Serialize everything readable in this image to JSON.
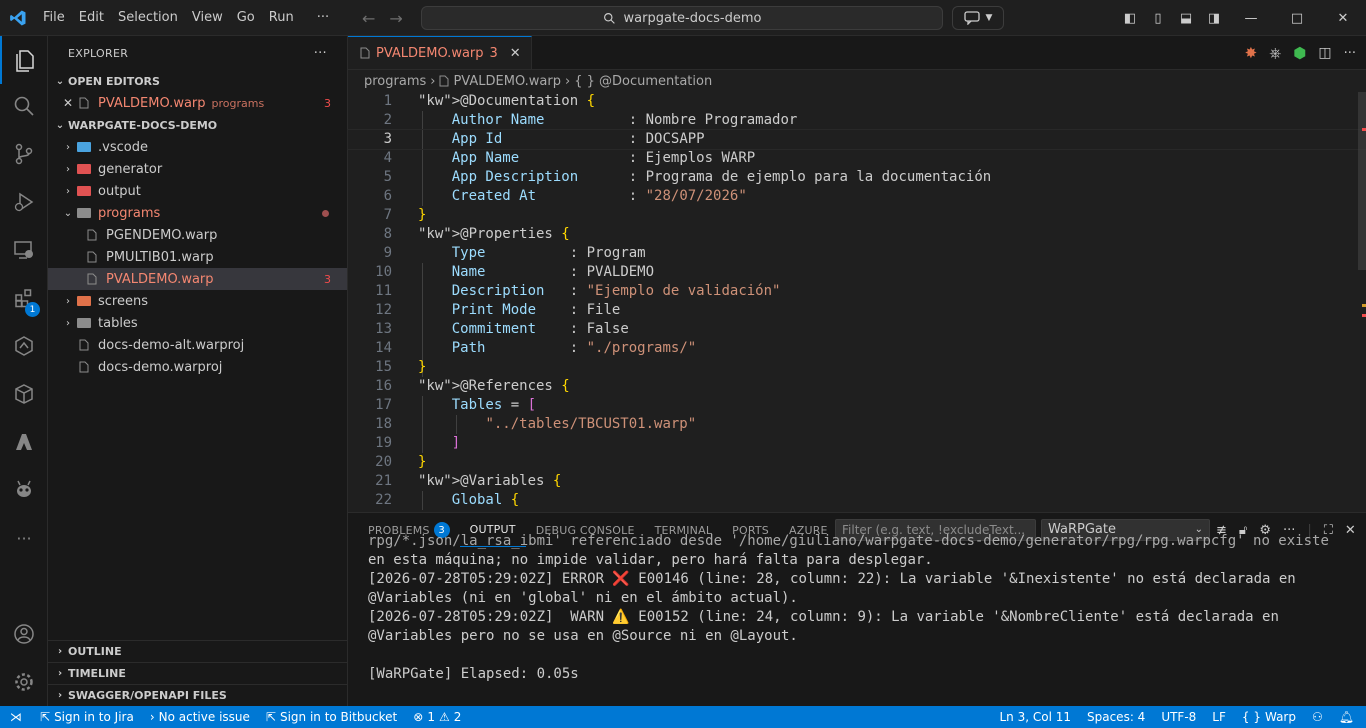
{
  "titlebar": {
    "menu": [
      "File",
      "Edit",
      "Selection",
      "View",
      "Go",
      "Run",
      "···"
    ],
    "search": "warpgate-docs-demo"
  },
  "activity": {
    "items": [
      "files-icon",
      "search-icon",
      "source-control-icon",
      "run-debug-icon",
      "remote-explorer-icon",
      "extensions-icon",
      "warp-icon",
      "cube-icon",
      "azure-icon",
      "alien-icon",
      "more-icon",
      "account-icon",
      "settings-icon"
    ],
    "extensions_badge": "1"
  },
  "sidebar": {
    "title": "EXPLORER",
    "more": "···",
    "open_editors": {
      "title": "OPEN EDITORS",
      "items": [
        {
          "name": "PVALDEMO.warp",
          "desc": "programs",
          "count": "3"
        }
      ]
    },
    "workspace": {
      "title": "WARPGATE-DOCS-DEMO",
      "items": [
        {
          "name": ".vscode",
          "type": "folder",
          "color": "#4aa3df"
        },
        {
          "name": "generator",
          "type": "folder",
          "color": "#e05252"
        },
        {
          "name": "output",
          "type": "folder",
          "color": "#e05252"
        },
        {
          "name": "programs",
          "type": "folder-open",
          "color": "#8c8c8c"
        },
        {
          "name": "PGENDEMO.warp",
          "type": "file"
        },
        {
          "name": "PMULTIB01.warp",
          "type": "file"
        },
        {
          "name": "PVALDEMO.warp",
          "type": "file",
          "count": "3"
        },
        {
          "name": "screens",
          "type": "folder",
          "color": "#e0724a"
        },
        {
          "name": "tables",
          "type": "folder",
          "color": "#8c8c8c"
        },
        {
          "name": "docs-demo-alt.warproj",
          "type": "file"
        },
        {
          "name": "docs-demo.warproj",
          "type": "file"
        }
      ]
    },
    "bottom_sections": [
      "OUTLINE",
      "TIMELINE",
      "SWAGGER/OPENAPI FILES"
    ]
  },
  "editor": {
    "tab": {
      "name": "PVALDEMO.warp",
      "count": "3"
    },
    "breadcrumb": [
      "programs",
      "PVALDEMO.warp",
      "{ } @Documentation"
    ],
    "lines": [
      "@Documentation {",
      "    Author Name          : Nombre Programador",
      "    App Id               : DOCSAPP",
      "    App Name             : Ejemplos WARP",
      "    App Description      : Programa de ejemplo para la documentación",
      "    Created At           : \"28/07/2026\"",
      "}",
      "@Properties {",
      "    Type          : Program",
      "    Name          : PVALDEMO",
      "    Description   : \"Ejemplo de validación\"",
      "    Print Mode    : File",
      "    Commitment    : False",
      "    Path          : \"./programs/\"",
      "}",
      "@References {",
      "    Tables = [",
      "        \"../tables/TBCUST01.warp\"",
      "    ]",
      "}",
      "@Variables {",
      "    Global {"
    ]
  },
  "panel": {
    "tabs": [
      {
        "label": "PROBLEMS",
        "badge": "3"
      },
      {
        "label": "OUTPUT"
      },
      {
        "label": "DEBUG CONSOLE"
      },
      {
        "label": "TERMINAL"
      },
      {
        "label": "PORTS"
      },
      {
        "label": "AZURE"
      }
    ],
    "filter_placeholder": "Filter (e.g. text, !excludeText...",
    "channel": "WaRPGate",
    "output": [
      "rpg/*.json/la_rsa_ibmi' referenciado desde '/home/giuliano/warpgate-docs-demo/generator/rpg/rpg.warpcfg' no existe",
      "en esta máquina; no impide validar, pero hará falta para desplegar.",
      "[2026-07-28T05:29:02Z] ERROR ❌ E00146 (line: 28, column: 22): La variable '&Inexistente' no está declarada en",
      "@Variables (ni en 'global' ni en el ámbito actual).",
      "[2026-07-28T05:29:02Z]  WARN ⚠️ E00152 (line: 24, column: 9): La variable '&NombreCliente' está declarada en",
      "@Variables pero no se usa en @Source ni en @Layout.",
      "",
      "[WaRPGate] Elapsed: 0.05s"
    ]
  },
  "status": {
    "jira": "Sign in to Jira",
    "issue": "No active issue",
    "bitbucket": "Sign in to Bitbucket",
    "errors": "1",
    "warnings": "2",
    "position": "Ln 3, Col 11",
    "spaces": "Spaces: 4",
    "encoding": "UTF-8",
    "eol": "LF",
    "language": "Warp"
  }
}
